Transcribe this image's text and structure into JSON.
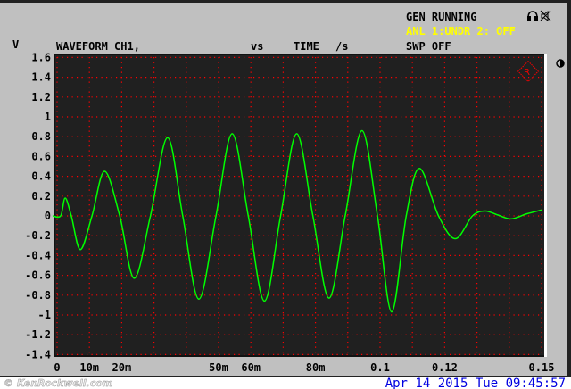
{
  "header": {
    "gen_status": "GEN RUNNING",
    "analyzer_status": "ANL 1:UNDR 2: OFF",
    "sweep_status": "SWP OFF",
    "y_unit": "V",
    "title": "WAVEFORM CH1,",
    "vs": "vs",
    "x_name": "TIME",
    "x_unit": "/s"
  },
  "footer": {
    "watermark": "© KenRockwell.com",
    "datetime": "Apr 14 2015 Tue 09:45:57"
  },
  "colors": {
    "trace": "#00ff00",
    "grid": "#ff0000",
    "plot_bg": "#202020",
    "panel": "#c0c0c0",
    "status": "#ffff00",
    "date": "#0000e0"
  },
  "chart_data": {
    "type": "line",
    "title": "WAVEFORM CH1, vs TIME",
    "xlabel": "TIME /s",
    "ylabel": "V",
    "xlim": [
      0,
      0.15
    ],
    "ylim": [
      -1.4,
      1.6
    ],
    "grid": true,
    "y_ticks": [
      "1.6",
      "1.4",
      "1.2",
      "1",
      "0.8",
      "0.6",
      "0.4",
      "0.2",
      "0",
      "-0.2",
      "-0.4",
      "-0.6",
      "-0.8",
      "-1",
      "-1.2",
      "-1.4"
    ],
    "x_tick_labels": [
      {
        "v": 0,
        "label": "0"
      },
      {
        "v": 0.01,
        "label": "10m"
      },
      {
        "v": 0.02,
        "label": "20m"
      },
      {
        "v": 0.05,
        "label": "50m"
      },
      {
        "v": 0.06,
        "label": "60m"
      },
      {
        "v": 0.08,
        "label": "80m"
      },
      {
        "v": 0.1,
        "label": "0.1"
      },
      {
        "v": 0.12,
        "label": "0.12"
      },
      {
        "v": 0.15,
        "label": "0.15"
      }
    ],
    "series": [
      {
        "name": "CH1",
        "points": [
          [
            -0.0014,
            0
          ],
          [
            0.0011,
            0
          ],
          [
            0.0025,
            0.18
          ],
          [
            0.0044,
            0
          ],
          [
            0.0072,
            -0.34
          ],
          [
            0.0108,
            0
          ],
          [
            0.0147,
            0.45
          ],
          [
            0.0194,
            0
          ],
          [
            0.0239,
            -0.63
          ],
          [
            0.0289,
            0
          ],
          [
            0.0342,
            0.79
          ],
          [
            0.0389,
            0
          ],
          [
            0.0439,
            -0.84
          ],
          [
            0.0492,
            0
          ],
          [
            0.0542,
            0.83
          ],
          [
            0.0592,
            0
          ],
          [
            0.0642,
            -0.86
          ],
          [
            0.0692,
            0
          ],
          [
            0.0742,
            0.83
          ],
          [
            0.0792,
            0
          ],
          [
            0.0842,
            -0.83
          ],
          [
            0.0892,
            0
          ],
          [
            0.0944,
            0.86
          ],
          [
            0.0992,
            0
          ],
          [
            0.1036,
            -0.97
          ],
          [
            0.1081,
            0
          ],
          [
            0.1122,
            0.48
          ],
          [
            0.1181,
            0
          ],
          [
            0.1233,
            -0.23
          ],
          [
            0.1286,
            0
          ],
          [
            0.1325,
            0.05
          ],
          [
            0.1364,
            0.01
          ],
          [
            0.1406,
            -0.03
          ],
          [
            0.1453,
            0.02
          ],
          [
            0.15,
            0.06
          ]
        ]
      }
    ]
  }
}
